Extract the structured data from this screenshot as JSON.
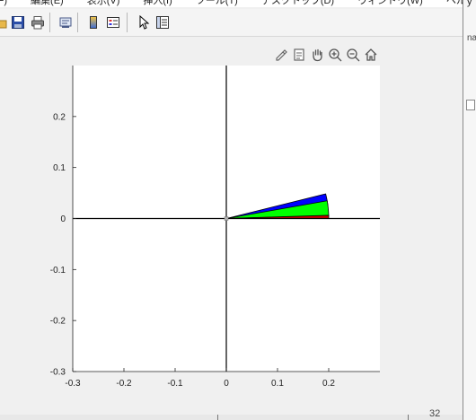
{
  "window": {
    "menu": [
      "(F)",
      "編集(E)",
      "表示(V)",
      "挿入(I)",
      "ツール(T)",
      "デスクトップ(D)",
      "ウィンドウ(W)",
      "ヘルプ(H)"
    ],
    "right_strip_text": "na",
    "right_strip_y": "y",
    "bottom_number": "32"
  },
  "toolbar": {
    "icons": [
      "open-folder-icon",
      "save-icon",
      "print-icon",
      "link-figure-icon",
      "colorbar-icon",
      "legend-icon",
      "pointer-icon",
      "property-inspector-icon"
    ]
  },
  "axes_toolbar": {
    "icons": [
      "brush-icon",
      "data-tip-icon",
      "pan-icon",
      "zoom-in-icon",
      "zoom-out-icon",
      "home-icon"
    ]
  },
  "chart_data": {
    "type": "area",
    "title": "",
    "xlabel": "",
    "ylabel": "",
    "xlim": [
      -0.3,
      0.3
    ],
    "ylim": [
      -0.3,
      0.3
    ],
    "xticks": [
      "-0.3",
      "-0.2",
      "-0.1",
      "0",
      "0.1",
      "0.2"
    ],
    "yticks": [
      "-0.3",
      "-0.2",
      "-0.1",
      "0",
      "0.1",
      "0.2"
    ],
    "xtick_values": [
      -0.3,
      -0.2,
      -0.1,
      0,
      0.1,
      0.2
    ],
    "ytick_values": [
      -0.3,
      -0.2,
      -0.1,
      0,
      0.1,
      0.2
    ],
    "grid": false,
    "reference_lines": {
      "x": 0,
      "y": 0,
      "color": "#000000"
    },
    "sectors": [
      {
        "name": "",
        "color": "#0000ff",
        "outer_radius": 0.2,
        "inner_radius": 0,
        "theta_start_deg": 7.5,
        "theta_end_deg": 14
      },
      {
        "name": "",
        "color": "#00ff00",
        "outer_radius": 0.2,
        "inner_radius": 0,
        "theta_start_deg": 1.5,
        "theta_end_deg": 10
      },
      {
        "name": "",
        "color": "#cc0000",
        "outer_radius": 0.2,
        "inner_radius": 0,
        "theta_start_deg": 0,
        "theta_end_deg": 1.8
      }
    ],
    "origin_marker": {
      "x": 0,
      "y": 0,
      "color": "#b0b0b0"
    }
  }
}
